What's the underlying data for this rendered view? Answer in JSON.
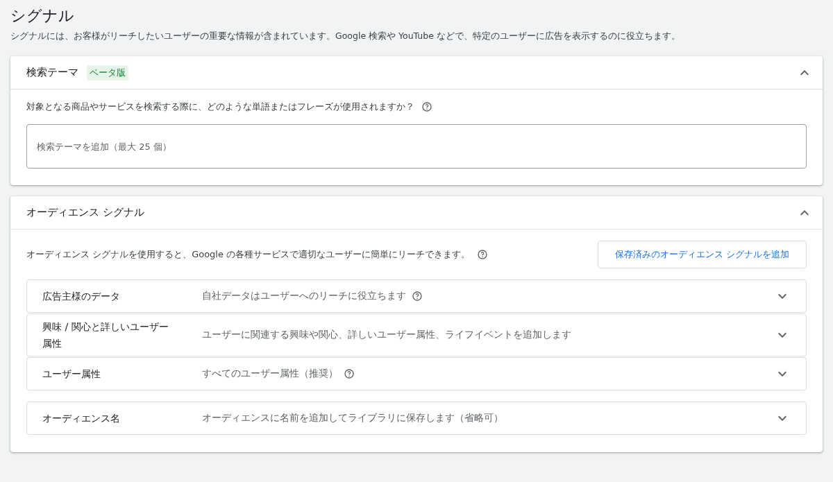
{
  "page": {
    "title": "シグナル",
    "description": "シグナルには、お客様がリーチしたいユーザーの重要な情報が含まれています。Google 検索や YouTube などで、特定のユーザーに広告を表示するのに役立ちます。"
  },
  "search_themes": {
    "title": "検索テーマ",
    "badge": "ベータ版",
    "expanded": true,
    "question": "対象となる商品やサービスを検索する際に、どのような単語またはフレーズが使用されますか？",
    "input": {
      "placeholder": "検索テーマを追加（最大 25 個）"
    }
  },
  "audience_signal": {
    "title": "オーディエンス シグナル",
    "expanded": true,
    "description": "オーディエンス シグナルを使用すると、Google の各種サービスで適切なユーザーに簡単にリーチできます。",
    "button": "保存済みのオーディエンス シグナルを追加",
    "rows": [
      {
        "label": "広告主様のデータ",
        "description": "自社データはユーザーへのリーチに役立ちます",
        "has_help": true,
        "expanded": false
      },
      {
        "label": "興味 / 関心と詳しいユーザー属性",
        "description": "ユーザーに関連する興味や関心、詳しいユーザー属性、ライフイベントを追加します",
        "has_help": false,
        "expanded": false
      },
      {
        "label": "ユーザー属性",
        "description": "すべてのユーザー属性（推奨）",
        "has_help": true,
        "expanded": false
      },
      {
        "label": "オーディエンス名",
        "description": "オーディエンスに名前を追加してライブラリに保存します（省略可）",
        "has_help": false,
        "expanded": false
      }
    ]
  }
}
